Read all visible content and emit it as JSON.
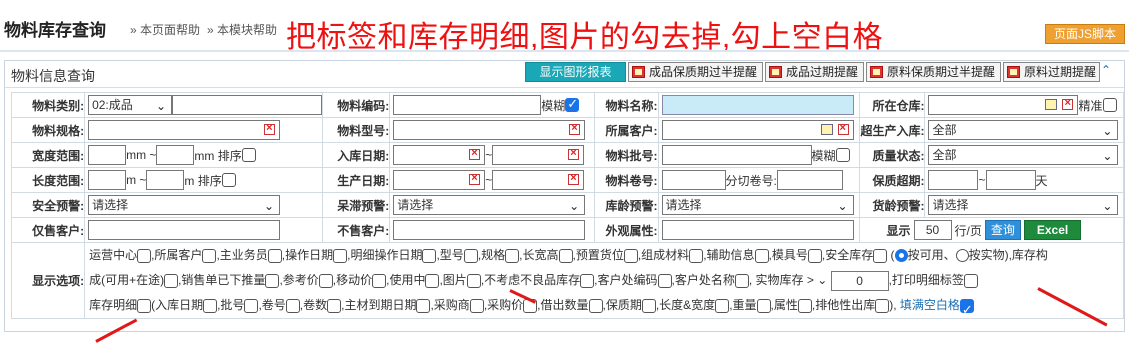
{
  "header": {
    "title": "物料库存查询",
    "help_page": "» 本页面帮助",
    "help_module": "» 本模块帮助",
    "annotation": "把标签和库存明细,图片的勾去掉,勾上空白格",
    "js_button": "页面JS脚本"
  },
  "panel": {
    "title": "物料信息查询",
    "show_chart_button": "显示图形报表",
    "warn_buttons": [
      "成品保质期过半提醒",
      "成品过期提醒",
      "原料保质期过半提醒",
      "原料过期提醒"
    ],
    "collapse_icon": "double-chevron-up"
  },
  "form": {
    "row1": {
      "l1": "物料类别:",
      "category_value": "02:成品",
      "l2": "物料编码:",
      "l2_suffix": "模糊",
      "l3": "物料名称:",
      "l4": "所在仓库:",
      "l4_suffix": "精准"
    },
    "row2": {
      "l1": "物料规格:",
      "l2": "物料型号:",
      "l3": "所属客户:",
      "l4": "超生产入库:",
      "l4_value": "全部"
    },
    "row3": {
      "l1": "宽度范围:",
      "u1": "mm ~",
      "u2": "mm 排序",
      "l2": "入库日期:",
      "tilde": "~",
      "l3": "物料批号:",
      "l3_suffix": "模糊",
      "l4": "质量状态:",
      "l4_value": "全部"
    },
    "row4": {
      "l1": "长度范围:",
      "u1": "m ~",
      "u2": "m 排序",
      "l2": "生产日期:",
      "tilde": "~",
      "l3": "物料卷号:",
      "l3_mid": "分切卷号:",
      "l4": "保质超期:",
      "l4_tilde": "~",
      "l4_unit": "天"
    },
    "row5": {
      "l1": "安全预警:",
      "v1": "请选择",
      "l2": "呆滞预警:",
      "v2": "请选择",
      "l3": "库龄预警:",
      "v3": "请选择",
      "l4": "货龄预警:",
      "v4": "请选择"
    },
    "row6": {
      "l1": "仅售客户:",
      "l2": "不售客户:",
      "l3": "外观属性:",
      "show": "显示",
      "per_page": "50",
      "per_page_unit": "行/页",
      "query": "查询",
      "excel": "Excel"
    },
    "options_label": "显示选项:",
    "options_line1": [
      "运营中心",
      "所属客户",
      "主业务员",
      "操作日期",
      "明细操作日期",
      "型号",
      "规格",
      "长宽高",
      "预置货位",
      "组成材料",
      "辅助信息",
      "模具号",
      "安全库存"
    ],
    "radio1": "按可用、",
    "radio2": "按实物),库存构",
    "options_line2_prefix": "成(可用+在途)",
    "options_line2": [
      "销售单已下推量",
      "参考价",
      "移动价",
      "使用中",
      "图片",
      "不考虑不良品库存",
      "客户处编码",
      "客户处名称"
    ],
    "stock_gt": "实物库存 >",
    "stock_value": "0",
    "print_label": ",打印明细标签",
    "options_line3_prefix": "库存明细",
    "options_line3": [
      "(入库日期",
      "批号",
      "卷号",
      "卷数",
      "主材到期日期",
      "采购商",
      "采购价",
      "借出数量",
      "保质期",
      "长度&宽度",
      "重量",
      "属性",
      "排他性出库"
    ],
    "fill_blank": "填满空白格"
  },
  "colors": {
    "accent": "#1aa7b6",
    "annotation": "#ee1111",
    "query": "#2f8fd8",
    "excel": "#1e8a3c",
    "js": "#f0a030"
  }
}
